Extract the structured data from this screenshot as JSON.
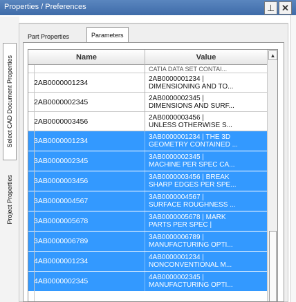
{
  "window": {
    "title": "Properties / Preferences",
    "pin_glyph": "⊥",
    "close_glyph": "✕"
  },
  "side_tabs": [
    {
      "label": "Select CAD Document Properties",
      "active": true
    },
    {
      "label": "Project Properties",
      "active": false
    }
  ],
  "tabs": [
    {
      "label": "Part Properties",
      "active": false
    },
    {
      "label": "Parameters",
      "active": true
    }
  ],
  "table": {
    "columns": [
      "Name",
      "Value"
    ],
    "partial_top_value": "CATIA DATA SET CONTAI...",
    "rows": [
      {
        "name": "2AB0000001234",
        "value_line1": "2AB0000001234 |",
        "value_line2": "DIMENSIONING AND TO...",
        "selected": false
      },
      {
        "name": "2AB0000002345",
        "value_line1": "2AB0000002345 |",
        "value_line2": "DIMENSIONS AND SURF...",
        "selected": false
      },
      {
        "name": "2AB0000003456",
        "value_line1": "2AB0000003456 |",
        "value_line2": "UNLESS OTHERWISE S...",
        "selected": false
      },
      {
        "name": "3AB0000001234",
        "value_line1": "3AB0000001234 | THE 3D",
        "value_line2": "GEOMETRY CONTAINED ...",
        "selected": true
      },
      {
        "name": "3AB0000002345",
        "value_line1": "3AB0000002345 |",
        "value_line2": "MACHINE PER SPEC CA...",
        "selected": true
      },
      {
        "name": "3AB0000003456",
        "value_line1": "3AB0000003456 | BREAK",
        "value_line2": "SHARP EDGES PER SPE...",
        "selected": true
      },
      {
        "name": "3AB0000004567",
        "value_line1": "3AB0000004567 |",
        "value_line2": "SURFACE ROUGHNESS ...",
        "selected": true
      },
      {
        "name": "3AB0000005678",
        "value_line1": "3AB0000005678 | MARK",
        "value_line2": "PARTS PER SPEC |",
        "selected": true
      },
      {
        "name": "3AB0000006789",
        "value_line1": "3AB0000006789 |",
        "value_line2": "MANUFACTURING OPTI...",
        "selected": true
      },
      {
        "name": "4AB0000001234",
        "value_line1": "4AB0000001234 |",
        "value_line2": "NONCONVENTIONAL M...",
        "selected": true
      },
      {
        "name": "4AB0000002345",
        "value_line1": "4AB0000002345 |",
        "value_line2": "MANUFACTURING OPTI...",
        "selected": true
      }
    ]
  },
  "scrollbar": {
    "up_glyph": "▲"
  },
  "colors": {
    "selection": "#3399ff",
    "titlebar": "#4a78b4"
  }
}
